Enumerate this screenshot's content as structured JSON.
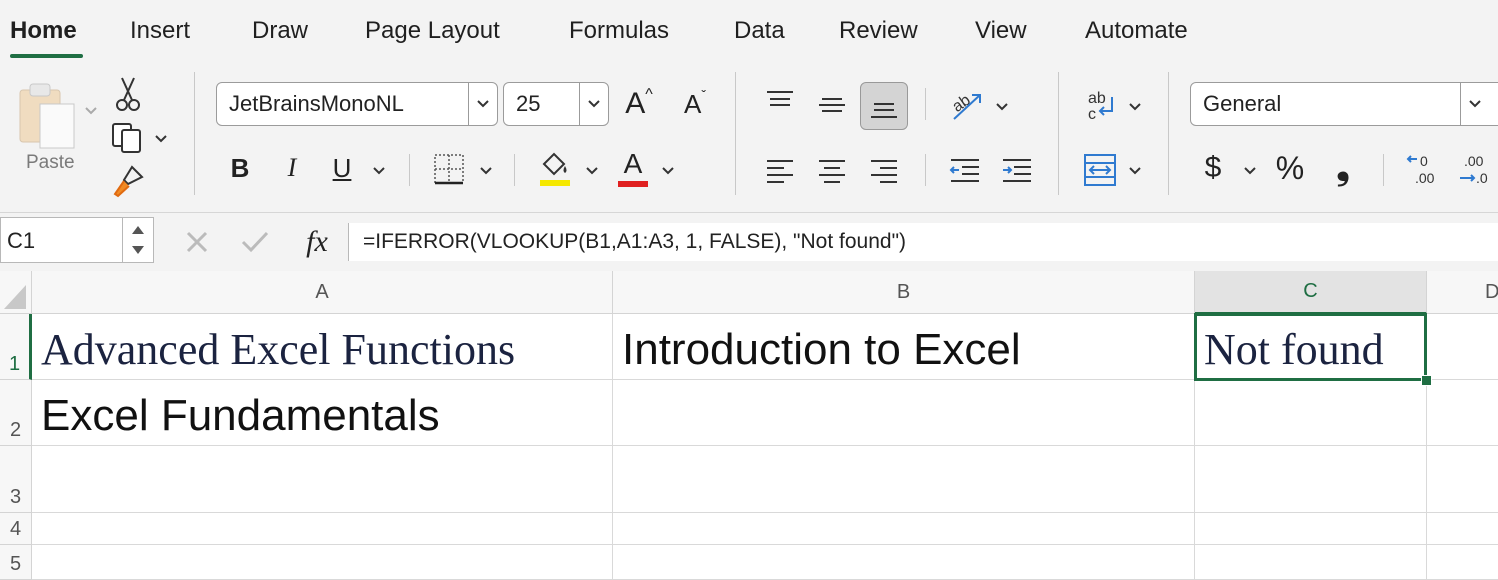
{
  "tabs": [
    {
      "label": "Home",
      "active": true
    },
    {
      "label": "Insert"
    },
    {
      "label": "Draw"
    },
    {
      "label": "Page Layout"
    },
    {
      "label": "Formulas"
    },
    {
      "label": "Data"
    },
    {
      "label": "Review"
    },
    {
      "label": "View"
    },
    {
      "label": "Automate"
    }
  ],
  "ribbon": {
    "paste_label": "Paste",
    "font_name": "JetBrainsMonoNL",
    "font_size": "25",
    "bold_label": "B",
    "italic_label": "I",
    "underline_label": "U",
    "font_color_label": "A",
    "grow_font_label": "A",
    "shrink_font_label": "A",
    "number_format": "General",
    "currency_label": "$",
    "percent_label": "%",
    "comma_label": "❟",
    "highlight_color": "#f5e800",
    "font_color": "#e02020"
  },
  "formula_bar": {
    "name_box": "C1",
    "formula": "=IFERROR(VLOOKUP(B1,A1:A3, 1, FALSE), \"Not found\")",
    "fx_label": "fx"
  },
  "sheet": {
    "columns": [
      "A",
      "B",
      "C",
      "D"
    ],
    "rows": [
      "1",
      "2",
      "3",
      "4",
      "5"
    ],
    "cells": {
      "A1": "Advanced Excel Functions",
      "B1": "Introduction to Excel",
      "C1": "Not found",
      "A2": "Excel Fundamentals"
    },
    "selected_cell": "C1",
    "accent": "#1f6e43"
  }
}
